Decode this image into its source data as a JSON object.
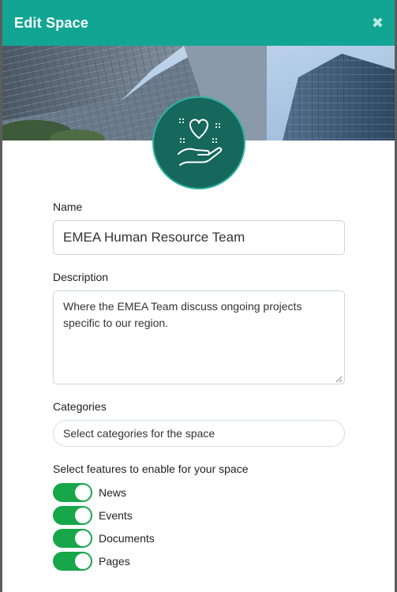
{
  "dialog": {
    "title": "Edit Space",
    "close_glyph": "✖"
  },
  "banner": {
    "image": "city-buildings-photo"
  },
  "space_icon": {
    "icon": "heart-hand-icon",
    "color": "#16675c"
  },
  "form": {
    "name_label": "Name",
    "name_value": "EMEA Human Resource Team",
    "description_label": "Description",
    "description_value": "Where the EMEA Team discuss ongoing projects specific to our region.",
    "categories_label": "Categories",
    "categories_placeholder": "Select categories for the space",
    "features_label": "Select features to enable for your space",
    "features": [
      {
        "label": "News",
        "enabled": true
      },
      {
        "label": "Events",
        "enabled": true
      },
      {
        "label": "Documents",
        "enabled": true
      },
      {
        "label": "Pages",
        "enabled": true
      }
    ]
  },
  "colors": {
    "header": "#13a593",
    "toggle_on": "#17a64a"
  }
}
